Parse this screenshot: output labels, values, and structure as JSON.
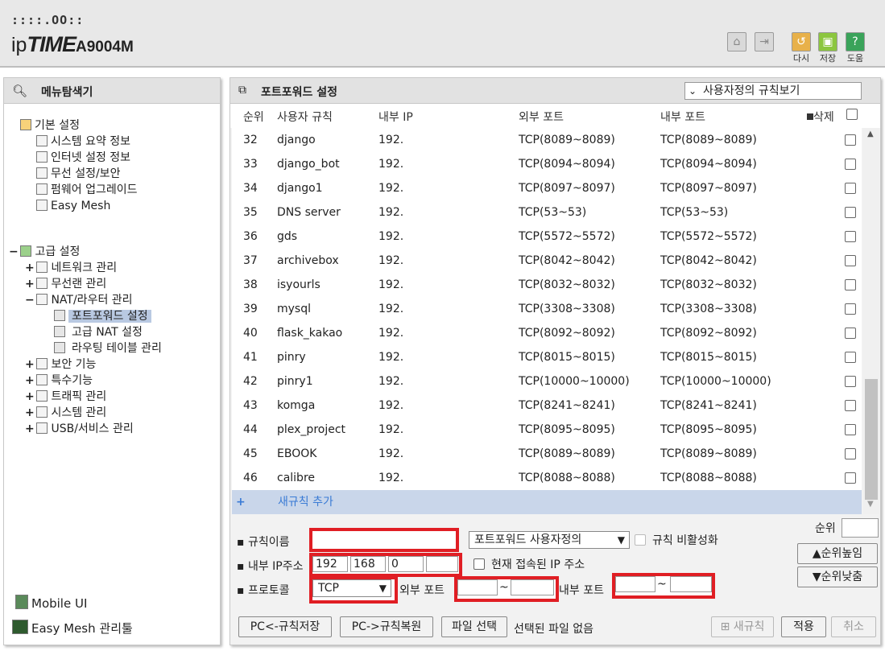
{
  "header": {
    "brand_dots": "::::.OO::",
    "brand_ip": "ip",
    "brand_time": "TIME",
    "model": "A9004M",
    "actions": [
      {
        "label": "다시",
        "icon": "restart-icon",
        "color": "#e8b14a"
      },
      {
        "label": "저장",
        "icon": "save-icon",
        "color": "#8cc63f"
      },
      {
        "label": "도움",
        "icon": "help-icon",
        "color": "#3aa35a"
      }
    ]
  },
  "sidebar": {
    "title": "메뉴탐색기",
    "basic": {
      "label": "기본 설정",
      "items": [
        "시스템 요약 정보",
        "인터넷 설정 정보",
        "무선 설정/보안",
        "펌웨어 업그레이드",
        "Easy Mesh"
      ]
    },
    "advanced": {
      "label": "고급 설정",
      "items": [
        "네트워크 관리",
        "무선랜 관리",
        "NAT/라우터 관리",
        "보안 기능",
        "특수기능",
        "트래픽 관리",
        "시스템 관리",
        "USB/서비스 관리"
      ],
      "nat_children": [
        "포트포워드 설정",
        "고급 NAT 설정",
        "라우팅 테이블 관리"
      ]
    },
    "footer": [
      "Mobile UI",
      "Easy Mesh 관리툴"
    ]
  },
  "main": {
    "title": "포트포워드 설정",
    "view_select": "사용자정의 규칙보기",
    "columns": [
      "순위",
      "사용자 규칙",
      "내부 IP",
      "외부 포트",
      "내부 포트",
      "삭제"
    ],
    "rows": [
      {
        "rank": "32",
        "name": "django",
        "ip": "192.",
        "ext": "TCP(8089~8089)",
        "int": "TCP(8089~8089)"
      },
      {
        "rank": "33",
        "name": "django_bot",
        "ip": "192.",
        "ext": "TCP(8094~8094)",
        "int": "TCP(8094~8094)"
      },
      {
        "rank": "34",
        "name": "django1",
        "ip": "192.",
        "ext": "TCP(8097~8097)",
        "int": "TCP(8097~8097)"
      },
      {
        "rank": "35",
        "name": "DNS server",
        "ip": "192.",
        "ext": "TCP(53~53)",
        "int": "TCP(53~53)"
      },
      {
        "rank": "36",
        "name": "gds",
        "ip": "192.",
        "ext": "TCP(5572~5572)",
        "int": "TCP(5572~5572)"
      },
      {
        "rank": "37",
        "name": "archivebox",
        "ip": "192.",
        "ext": "TCP(8042~8042)",
        "int": "TCP(8042~8042)"
      },
      {
        "rank": "38",
        "name": "isyourls",
        "ip": "192.",
        "ext": "TCP(8032~8032)",
        "int": "TCP(8032~8032)"
      },
      {
        "rank": "39",
        "name": "mysql",
        "ip": "192.",
        "ext": "TCP(3308~3308)",
        "int": "TCP(3308~3308)"
      },
      {
        "rank": "40",
        "name": "flask_kakao",
        "ip": "192.",
        "ext": "TCP(8092~8092)",
        "int": "TCP(8092~8092)"
      },
      {
        "rank": "41",
        "name": "pinry",
        "ip": "192.",
        "ext": "TCP(8015~8015)",
        "int": "TCP(8015~8015)"
      },
      {
        "rank": "42",
        "name": "pinry1",
        "ip": "192.",
        "ext": "TCP(10000~10000)",
        "int": "TCP(10000~10000)"
      },
      {
        "rank": "43",
        "name": "komga",
        "ip": "192.",
        "ext": "TCP(8241~8241)",
        "int": "TCP(8241~8241)"
      },
      {
        "rank": "44",
        "name": "plex_project",
        "ip": "192.",
        "ext": "TCP(8095~8095)",
        "int": "TCP(8095~8095)"
      },
      {
        "rank": "45",
        "name": "EBOOK",
        "ip": "192.",
        "ext": "TCP(8089~8089)",
        "int": "TCP(8089~8089)"
      },
      {
        "rank": "46",
        "name": "calibre",
        "ip": "192.",
        "ext": "TCP(8088~8088)",
        "int": "TCP(8088~8088)"
      }
    ],
    "add_rule": "새규칙 추가"
  },
  "form": {
    "rule_name_label": "규칙이름",
    "rule_name_value": "",
    "preset_select": "포트포워드 사용자정의",
    "disable_rule_label": "규칙 비활성화",
    "rank_label": "순위",
    "rank_value": "",
    "ip_label": "내부 IP주소",
    "ip_octets": [
      "192",
      "168",
      "0",
      ""
    ],
    "current_ip_label": "현재 접속된 IP 주소",
    "rank_up": "순위높임",
    "rank_down": "순위낮춤",
    "protocol_label": "프로토콜",
    "protocol_value": "TCP",
    "ext_port_label": "외부 포트",
    "int_port_label": "내부 포트",
    "tilde": "~",
    "btn_pc_save": "PC<-규칙저장",
    "btn_pc_restore": "PC->규칙복원",
    "btn_file": "파일 선택",
    "file_status": "선택된 파일 없음",
    "btn_new_rule": "새규칙",
    "btn_apply": "적용",
    "btn_cancel": "취소"
  },
  "colors": {
    "highlight": "#e01e24",
    "selected": "#b9c9e2",
    "add_row": "#c9d6ea"
  }
}
